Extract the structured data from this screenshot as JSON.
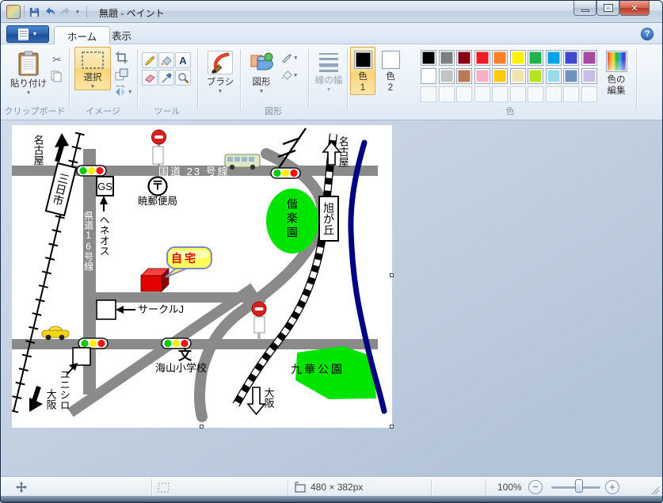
{
  "window": {
    "title": "無題 - ペイント"
  },
  "tabs": {
    "home": "ホーム",
    "view": "表示"
  },
  "icons": {
    "dropdown": "▼",
    "close": "✕",
    "help": "?",
    "scissors": "✂",
    "minus": "−",
    "plus": "+"
  },
  "ribbon": {
    "paste_label": "貼り付け",
    "group_clipboard": "クリップボード",
    "select_label": "選択",
    "group_image": "イメージ",
    "group_tools": "ツール",
    "text_tool_label": "A",
    "brush_label": "ブラシ",
    "shapes_label": "図形",
    "group_shapes": "図形",
    "line_width_label": "線の幅",
    "color1_label": "色",
    "color1_num": "1",
    "color2_label": "色",
    "color2_num": "2",
    "edit_colors_1": "色の",
    "edit_colors_2": "編集",
    "group_colors": "色",
    "palette_row1": [
      "#000000",
      "#7f7f7f",
      "#880015",
      "#ed1c24",
      "#ff7f27",
      "#fff200",
      "#22b14c",
      "#00a2e8",
      "#3f48cc",
      "#a349a4"
    ],
    "palette_row2": [
      "#ffffff",
      "#c3c3c3",
      "#b97a57",
      "#ffaec9",
      "#ffc90e",
      "#efe4b0",
      "#b5e61d",
      "#99d9ea",
      "#7092be",
      "#c8bfe7"
    ],
    "palette_empty_count": 10
  },
  "map": {
    "route23": "国道 23 号線",
    "route16": "県道16号線",
    "nagoya_nw": "名古屋",
    "nagoya_ne": "名古屋",
    "osaka_sw": "大阪",
    "osaka_s": "大阪",
    "station_mikkaichi": "三日市",
    "station_asahigaoka": "旭が丘",
    "park_kairakuen": "偕楽園",
    "park_kyuka": "九華公園",
    "post_mark": "〒",
    "post_office": "暁郵便局",
    "gs": "GS",
    "gs_note": "ヘネオス",
    "home": "自宅",
    "circle_j": "サークルJ",
    "unishiro": "ユニシロ",
    "school_mark": "文",
    "school": "海山小学校"
  },
  "statusbar": {
    "size": "480 × 382px",
    "zoom": "100%"
  }
}
